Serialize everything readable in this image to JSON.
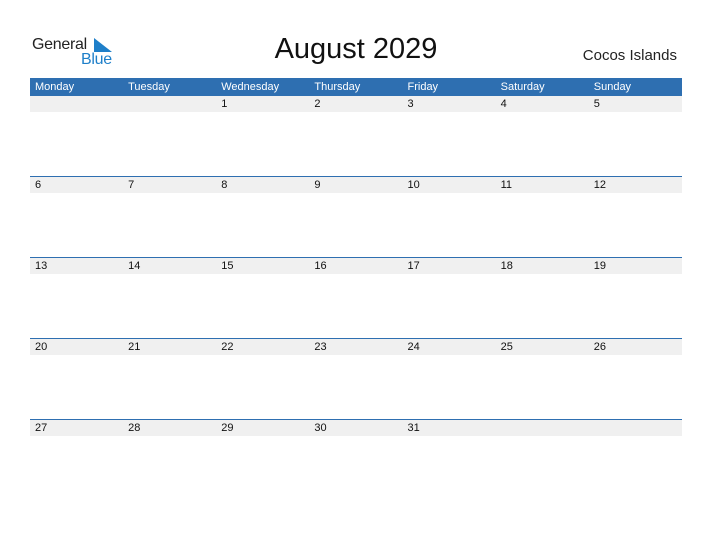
{
  "logo": {
    "general": "General",
    "blue": "Blue"
  },
  "header": {
    "title": "August 2029",
    "country": "Cocos Islands"
  },
  "colors": {
    "accent": "#2e6fb1",
    "date_row_bg": "#f0f0f0",
    "logo_blue": "#1e7fc9"
  },
  "calendar": {
    "weekdays": [
      "Monday",
      "Tuesday",
      "Wednesday",
      "Thursday",
      "Friday",
      "Saturday",
      "Sunday"
    ],
    "weeks": [
      [
        "",
        "",
        "1",
        "2",
        "3",
        "4",
        "5"
      ],
      [
        "6",
        "7",
        "8",
        "9",
        "10",
        "11",
        "12"
      ],
      [
        "13",
        "14",
        "15",
        "16",
        "17",
        "18",
        "19"
      ],
      [
        "20",
        "21",
        "22",
        "23",
        "24",
        "25",
        "26"
      ],
      [
        "27",
        "28",
        "29",
        "30",
        "31",
        "",
        ""
      ]
    ]
  }
}
